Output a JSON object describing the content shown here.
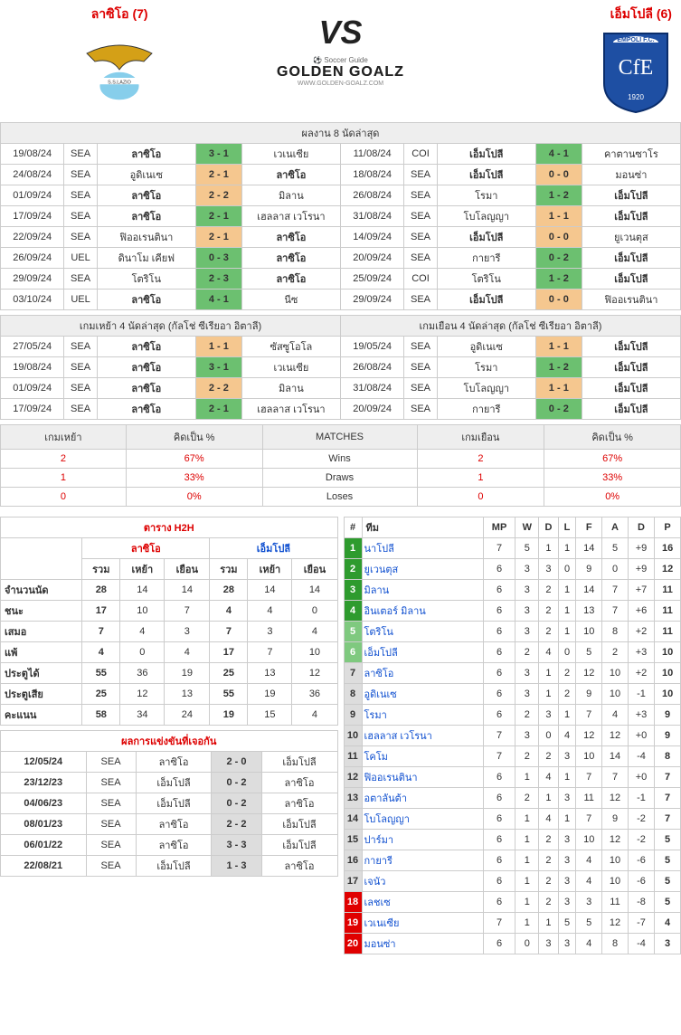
{
  "header": {
    "teamA": "ลาซิโอ (7)",
    "teamB": "เอ็มโปลี (6)",
    "vs": "VS",
    "brand_top": "Soccer Guide",
    "brand": "GOLDEN GOALZ",
    "brand_sub": "WWW.GOLDEN-GOALZ.COM"
  },
  "last8": {
    "title": "ผลงาน 8 นัดล่าสุด",
    "left": [
      {
        "d": "19/08/24",
        "c": "SEA",
        "h": "ลาซิโอ",
        "s": "3 - 1",
        "cls": "green",
        "a": "เวเนเซีย"
      },
      {
        "d": "24/08/24",
        "c": "SEA",
        "h": "อูดิเนเซ",
        "s": "2 - 1",
        "cls": "orange",
        "a": "ลาซิโอ"
      },
      {
        "d": "01/09/24",
        "c": "SEA",
        "h": "ลาซิโอ",
        "s": "2 - 2",
        "cls": "orange",
        "a": "มิลาน"
      },
      {
        "d": "17/09/24",
        "c": "SEA",
        "h": "ลาซิโอ",
        "s": "2 - 1",
        "cls": "green",
        "a": "เฮลลาส เวโรนา"
      },
      {
        "d": "22/09/24",
        "c": "SEA",
        "h": "ฟิออเรนตินา",
        "s": "2 - 1",
        "cls": "orange",
        "a": "ลาซิโอ"
      },
      {
        "d": "26/09/24",
        "c": "UEL",
        "h": "ดินาโม เคียฟ",
        "s": "0 - 3",
        "cls": "green",
        "a": "ลาซิโอ"
      },
      {
        "d": "29/09/24",
        "c": "SEA",
        "h": "โตริโน",
        "s": "2 - 3",
        "cls": "green",
        "a": "ลาซิโอ"
      },
      {
        "d": "03/10/24",
        "c": "UEL",
        "h": "ลาซิโอ",
        "s": "4 - 1",
        "cls": "green",
        "a": "นีซ"
      }
    ],
    "right": [
      {
        "d": "11/08/24",
        "c": "COI",
        "h": "เอ็มโปลี",
        "s": "4 - 1",
        "cls": "green",
        "a": "คาตานซาโร"
      },
      {
        "d": "18/08/24",
        "c": "SEA",
        "h": "เอ็มโปลี",
        "s": "0 - 0",
        "cls": "orange",
        "a": "มอนซ่า"
      },
      {
        "d": "26/08/24",
        "c": "SEA",
        "h": "โรมา",
        "s": "1 - 2",
        "cls": "green",
        "a": "เอ็มโปลี"
      },
      {
        "d": "31/08/24",
        "c": "SEA",
        "h": "โบโลญญา",
        "s": "1 - 1",
        "cls": "orange",
        "a": "เอ็มโปลี"
      },
      {
        "d": "14/09/24",
        "c": "SEA",
        "h": "เอ็มโปลี",
        "s": "0 - 0",
        "cls": "orange",
        "a": "ยูเวนตุส"
      },
      {
        "d": "20/09/24",
        "c": "SEA",
        "h": "กายารี",
        "s": "0 - 2",
        "cls": "green",
        "a": "เอ็มโปลี"
      },
      {
        "d": "25/09/24",
        "c": "COI",
        "h": "โตริโน",
        "s": "1 - 2",
        "cls": "green",
        "a": "เอ็มโปลี"
      },
      {
        "d": "29/09/24",
        "c": "SEA",
        "h": "เอ็มโปลี",
        "s": "0 - 0",
        "cls": "orange",
        "a": "ฟิออเรนตินา"
      }
    ]
  },
  "last4": {
    "titleL": "เกมเหย้า 4 นัดล่าสุด (กัลโช่ ซีเรียอา อิตาลี)",
    "titleR": "เกมเยือน 4 นัดล่าสุด (กัลโช่ ซีเรียอา อิตาลี)",
    "left": [
      {
        "d": "27/05/24",
        "c": "SEA",
        "h": "ลาซิโอ",
        "s": "1 - 1",
        "cls": "orange",
        "a": "ซัสซูโอโล"
      },
      {
        "d": "19/08/24",
        "c": "SEA",
        "h": "ลาซิโอ",
        "s": "3 - 1",
        "cls": "green",
        "a": "เวเนเซีย"
      },
      {
        "d": "01/09/24",
        "c": "SEA",
        "h": "ลาซิโอ",
        "s": "2 - 2",
        "cls": "orange",
        "a": "มิลาน"
      },
      {
        "d": "17/09/24",
        "c": "SEA",
        "h": "ลาซิโอ",
        "s": "2 - 1",
        "cls": "green",
        "a": "เฮลลาส เวโรนา"
      }
    ],
    "right": [
      {
        "d": "19/05/24",
        "c": "SEA",
        "h": "อูดิเนเซ",
        "s": "1 - 1",
        "cls": "orange",
        "a": "เอ็มโปลี"
      },
      {
        "d": "26/08/24",
        "c": "SEA",
        "h": "โรมา",
        "s": "1 - 2",
        "cls": "green",
        "a": "เอ็มโปลี"
      },
      {
        "d": "31/08/24",
        "c": "SEA",
        "h": "โบโลญญา",
        "s": "1 - 1",
        "cls": "orange",
        "a": "เอ็มโปลี"
      },
      {
        "d": "20/09/24",
        "c": "SEA",
        "h": "กายารี",
        "s": "0 - 2",
        "cls": "green",
        "a": "เอ็มโปลี"
      }
    ]
  },
  "wld": {
    "hdr": {
      "home": "เกมเหย้า",
      "pctL": "คิดเป็น %",
      "matches": "MATCHES",
      "away": "เกมเยือน",
      "pctR": "คิดเป็น %"
    },
    "rows": [
      {
        "hv": "2",
        "hp": "67%",
        "lbl": "Wins",
        "av": "2",
        "ap": "67%"
      },
      {
        "hv": "1",
        "hp": "33%",
        "lbl": "Draws",
        "av": "1",
        "ap": "33%"
      },
      {
        "hv": "0",
        "hp": "0%",
        "lbl": "Loses",
        "av": "0",
        "ap": "0%"
      }
    ]
  },
  "h2h": {
    "title": "ตาราง H2H",
    "teamA": "ลาซิโอ",
    "teamB": "เอ็มโปลี",
    "cols": {
      "total": "รวม",
      "home": "เหย้า",
      "away": "เยือน"
    },
    "rows": [
      {
        "lbl": "จำนวนนัด",
        "a": [
          "28",
          "14",
          "14"
        ],
        "b": [
          "28",
          "14",
          "14"
        ]
      },
      {
        "lbl": "ชนะ",
        "a": [
          "17",
          "10",
          "7"
        ],
        "b": [
          "4",
          "4",
          "0"
        ]
      },
      {
        "lbl": "เสมอ",
        "a": [
          "7",
          "4",
          "3"
        ],
        "b": [
          "7",
          "3",
          "4"
        ]
      },
      {
        "lbl": "แพ้",
        "a": [
          "4",
          "0",
          "4"
        ],
        "b": [
          "17",
          "7",
          "10"
        ]
      },
      {
        "lbl": "ประตูได้",
        "a": [
          "55",
          "36",
          "19"
        ],
        "b": [
          "25",
          "13",
          "12"
        ]
      },
      {
        "lbl": "ประตูเสีย",
        "a": [
          "25",
          "12",
          "13"
        ],
        "b": [
          "55",
          "19",
          "36"
        ]
      },
      {
        "lbl": "คะแนน",
        "a": [
          "58",
          "34",
          "24"
        ],
        "b": [
          "19",
          "15",
          "4"
        ]
      }
    ],
    "meetings_title": "ผลการแข่งขันที่เจอกัน",
    "meetings": [
      {
        "d": "12/05/24",
        "c": "SEA",
        "h": "ลาซิโอ",
        "s": "2 - 0",
        "a": "เอ็มโปลี"
      },
      {
        "d": "23/12/23",
        "c": "SEA",
        "h": "เอ็มโปลี",
        "s": "0 - 2",
        "a": "ลาซิโอ"
      },
      {
        "d": "04/06/23",
        "c": "SEA",
        "h": "เอ็มโปลี",
        "s": "0 - 2",
        "a": "ลาซิโอ"
      },
      {
        "d": "08/01/23",
        "c": "SEA",
        "h": "ลาซิโอ",
        "s": "2 - 2",
        "a": "เอ็มโปลี"
      },
      {
        "d": "06/01/22",
        "c": "SEA",
        "h": "ลาซิโอ",
        "s": "3 - 3",
        "a": "เอ็มโปลี"
      },
      {
        "d": "22/08/21",
        "c": "SEA",
        "h": "เอ็มโปลี",
        "s": "1 - 3",
        "a": "ลาซิโอ"
      }
    ]
  },
  "standings": {
    "hdr": {
      "rank": "#",
      "team": "ทีม",
      "mp": "MP",
      "w": "W",
      "d": "D",
      "l": "L",
      "f": "F",
      "a": "A",
      "diff": "D",
      "p": "P"
    },
    "rows": [
      {
        "r": "1",
        "cls": "rank-cl",
        "t": "นาโปลี",
        "v": [
          "7",
          "5",
          "1",
          "1",
          "14",
          "5",
          "+9",
          "16"
        ]
      },
      {
        "r": "2",
        "cls": "rank-cl",
        "t": "ยูเวนตุส",
        "v": [
          "6",
          "3",
          "3",
          "0",
          "9",
          "0",
          "+9",
          "12"
        ]
      },
      {
        "r": "3",
        "cls": "rank-cl",
        "t": "มิลาน",
        "v": [
          "6",
          "3",
          "2",
          "1",
          "14",
          "7",
          "+7",
          "11"
        ]
      },
      {
        "r": "4",
        "cls": "rank-cl",
        "t": "อินเตอร์ มิลาน",
        "v": [
          "6",
          "3",
          "2",
          "1",
          "13",
          "7",
          "+6",
          "11"
        ]
      },
      {
        "r": "5",
        "cls": "rank-el",
        "t": "โตริโน",
        "v": [
          "6",
          "3",
          "2",
          "1",
          "10",
          "8",
          "+2",
          "11"
        ]
      },
      {
        "r": "6",
        "cls": "rank-el",
        "t": "เอ็มโปลี",
        "v": [
          "6",
          "2",
          "4",
          "0",
          "5",
          "2",
          "+3",
          "10"
        ]
      },
      {
        "r": "7",
        "cls": "rank-mid",
        "t": "ลาซิโอ",
        "v": [
          "6",
          "3",
          "1",
          "2",
          "12",
          "10",
          "+2",
          "10"
        ]
      },
      {
        "r": "8",
        "cls": "rank-mid",
        "t": "อูดิเนเซ",
        "v": [
          "6",
          "3",
          "1",
          "2",
          "9",
          "10",
          "-1",
          "10"
        ]
      },
      {
        "r": "9",
        "cls": "rank-mid",
        "t": "โรมา",
        "v": [
          "6",
          "2",
          "3",
          "1",
          "7",
          "4",
          "+3",
          "9"
        ]
      },
      {
        "r": "10",
        "cls": "rank-mid",
        "t": "เฮลลาส เวโรนา",
        "v": [
          "7",
          "3",
          "0",
          "4",
          "12",
          "12",
          "+0",
          "9"
        ]
      },
      {
        "r": "11",
        "cls": "rank-mid",
        "t": "โคโม",
        "v": [
          "7",
          "2",
          "2",
          "3",
          "10",
          "14",
          "-4",
          "8"
        ]
      },
      {
        "r": "12",
        "cls": "rank-mid",
        "t": "ฟิออเรนตินา",
        "v": [
          "6",
          "1",
          "4",
          "1",
          "7",
          "7",
          "+0",
          "7"
        ]
      },
      {
        "r": "13",
        "cls": "rank-mid",
        "t": "อตาลันต้า",
        "v": [
          "6",
          "2",
          "1",
          "3",
          "11",
          "12",
          "-1",
          "7"
        ]
      },
      {
        "r": "14",
        "cls": "rank-mid",
        "t": "โบโลญญา",
        "v": [
          "6",
          "1",
          "4",
          "1",
          "7",
          "9",
          "-2",
          "7"
        ]
      },
      {
        "r": "15",
        "cls": "rank-mid",
        "t": "ปาร์มา",
        "v": [
          "6",
          "1",
          "2",
          "3",
          "10",
          "12",
          "-2",
          "5"
        ]
      },
      {
        "r": "16",
        "cls": "rank-mid",
        "t": "กายารี",
        "v": [
          "6",
          "1",
          "2",
          "3",
          "4",
          "10",
          "-6",
          "5"
        ]
      },
      {
        "r": "17",
        "cls": "rank-mid",
        "t": "เจนัว",
        "v": [
          "6",
          "1",
          "2",
          "3",
          "4",
          "10",
          "-6",
          "5"
        ]
      },
      {
        "r": "18",
        "cls": "rank-rel",
        "t": "เลชเซ",
        "v": [
          "6",
          "1",
          "2",
          "3",
          "3",
          "11",
          "-8",
          "5"
        ]
      },
      {
        "r": "19",
        "cls": "rank-rel",
        "t": "เวเนเซีย",
        "v": [
          "7",
          "1",
          "1",
          "5",
          "5",
          "12",
          "-7",
          "4"
        ]
      },
      {
        "r": "20",
        "cls": "rank-rel",
        "t": "มอนซ่า",
        "v": [
          "6",
          "0",
          "3",
          "3",
          "4",
          "8",
          "-4",
          "3"
        ]
      }
    ]
  }
}
